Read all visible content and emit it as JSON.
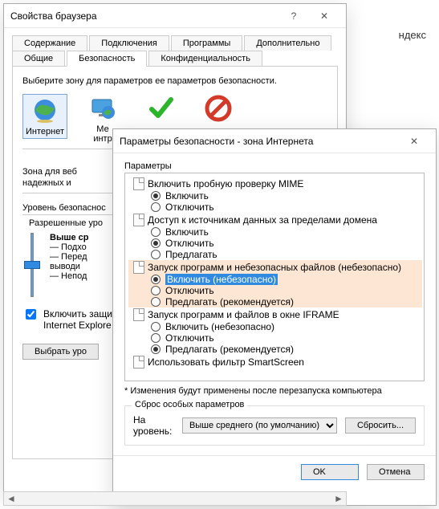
{
  "bg_text": "ндекс",
  "win1": {
    "title": "Свойства браузера",
    "tabs_row1": [
      "Содержание",
      "Подключения",
      "Программы",
      "Дополнительно"
    ],
    "tabs_row2": [
      "Общие",
      "Безопасность",
      "Конфиденциальность"
    ],
    "active_tab": "Безопасность",
    "zone_prompt": "Выберите зону для параметров ее параметров безопасности.",
    "zones": {
      "internet": "Интернет",
      "local": "Ме",
      "local2": "интр"
    },
    "zone_title": "Интернет",
    "zone_desc1": "Зона для веб",
    "zone_desc2": "надежных и",
    "level_label": "Уровень безопаснос",
    "level_sub": "Разрешенные уро",
    "level_title": "Выше ср",
    "level_lines": [
      "— Подхо",
      "— Перед",
      "выводи",
      "— Непод"
    ],
    "chk_label1": "Включить защи",
    "chk_label2": "Internet Explore",
    "btn_select": "Выбрать уро"
  },
  "win2": {
    "title": "Параметры безопасности - зона Интернета",
    "params_label": "Параметры",
    "tree": {
      "cat1": "Включить пробную проверку MIME",
      "cat1_opts": {
        "enable": "Включить",
        "disable": "Отключить"
      },
      "cat2": "Доступ к источникам данных за пределами домена",
      "cat2_opts": {
        "enable": "Включить",
        "disable": "Отключить",
        "prompt": "Предлагать"
      },
      "cat3": "Запуск программ и небезопасных файлов (небезопасно)",
      "cat3_opts": {
        "enable": "Включить (небезопасно)",
        "disable": "Отключить",
        "prompt": "Предлагать (рекомендуется)"
      },
      "cat4": "Запуск программ и файлов в окне IFRAME",
      "cat4_opts": {
        "enable": "Включить (небезопасно)",
        "disable": "Отключить",
        "prompt": "Предлагать (рекомендуется)"
      },
      "cat5": "Использовать фильтр SmartScreen"
    },
    "note": "* Изменения будут применены после перезапуска компьютера",
    "reset_legend": "Сброс особых параметров",
    "reset_label": "На уровень:",
    "reset_combo": "Выше среднего (по умолчанию)",
    "reset_btn": "Сбросить...",
    "ok": "OK",
    "cancel": "Отмена"
  }
}
